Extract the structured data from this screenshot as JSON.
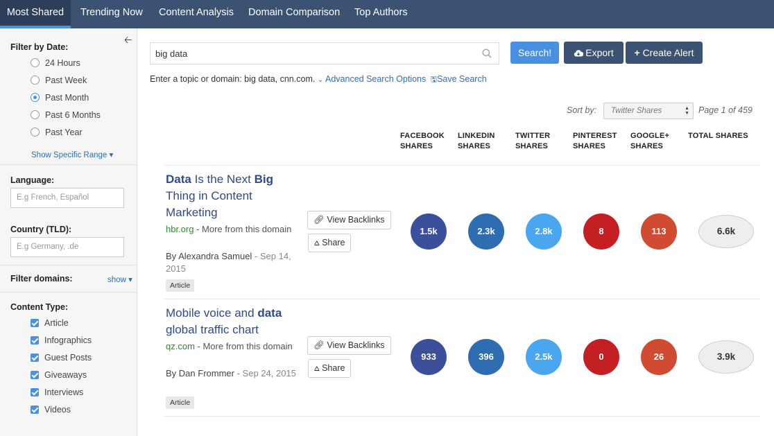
{
  "nav": {
    "tabs": [
      {
        "label": "Most Shared"
      },
      {
        "label": "Trending Now"
      },
      {
        "label": "Content Analysis"
      },
      {
        "label": "Domain Comparison"
      },
      {
        "label": "Top Authors"
      }
    ]
  },
  "sidebar": {
    "date_label": "Filter by Date:",
    "date_options": [
      "24 Hours",
      "Past Week",
      "Past Month",
      "Past 6 Months",
      "Past Year"
    ],
    "date_selected": "Past Month",
    "show_range": "Show Specific Range",
    "language_label": "Language:",
    "language_placeholder": "E.g French, Español",
    "country_label": "Country (TLD):",
    "country_placeholder": "E.g Germany, .de",
    "filter_domains_label": "Filter domains:",
    "filter_domains_show": "show",
    "content_type_label": "Content Type:",
    "content_types": [
      "Article",
      "Infographics",
      "Guest Posts",
      "Giveaways",
      "Interviews",
      "Videos"
    ]
  },
  "search": {
    "value": "big data",
    "search_button": "Search!",
    "export_button": "Export",
    "alert_button": "Create Alert",
    "hint": "Enter a topic or domain: big data, cnn.com.",
    "advanced": "Advanced Search Options",
    "save": "Save Search"
  },
  "sort": {
    "label": "Sort by:",
    "selected": "Twitter Shares",
    "page_info": "Page 1 of 459"
  },
  "columns": [
    {
      "line1": "FACEBOOK",
      "line2": "SHARES"
    },
    {
      "line1": "LINKEDIN",
      "line2": "SHARES"
    },
    {
      "line1": "TWITTER",
      "line2": "SHARES"
    },
    {
      "line1": "PINTEREST",
      "line2": "SHARES"
    },
    {
      "line1": "GOOGLE+",
      "line2": "SHARES"
    },
    {
      "line1": "TOTAL SHARES",
      "line2": ""
    }
  ],
  "actions": {
    "backlinks": "View Backlinks",
    "share": "Share"
  },
  "results": [
    {
      "title_parts": [
        {
          "text": "Data",
          "bold": true
        },
        {
          "text": " Is the Next ",
          "bold": false
        },
        {
          "text": "Big",
          "bold": true
        },
        {
          "text": " Thing in Content Marketing",
          "bold": false
        }
      ],
      "domain": "hbr.org",
      "more": " - More from this domain",
      "by": "By ",
      "author": "Alexandra Samuel",
      "date": " - Sep 14, 2015",
      "tag": "Article",
      "shares": [
        "1.5k",
        "2.3k",
        "2.8k",
        "8",
        "113"
      ],
      "total": "6.6k"
    },
    {
      "title_parts": [
        {
          "text": "Mobile voice and ",
          "bold": false
        },
        {
          "text": "data",
          "bold": true
        },
        {
          "text": " global traffic chart",
          "bold": false
        }
      ],
      "domain": "qz.com",
      "more": " - More from this domain",
      "by": "By ",
      "author": "Dan Frommer",
      "date": " - Sep 24, 2015",
      "tag": "Article",
      "shares": [
        "933",
        "396",
        "2.5k",
        "0",
        "26"
      ],
      "total": "3.9k"
    }
  ],
  "colors": {
    "nav_bg": "#3b5273",
    "facebook": "#3c4f9a",
    "linkedin": "#2f6db2",
    "twitter": "#4aa6ee",
    "pinterest": "#c41f23",
    "googleplus": "#d14a32",
    "search_btn": "#4a90e2",
    "dark_btn": "#3b5273"
  }
}
